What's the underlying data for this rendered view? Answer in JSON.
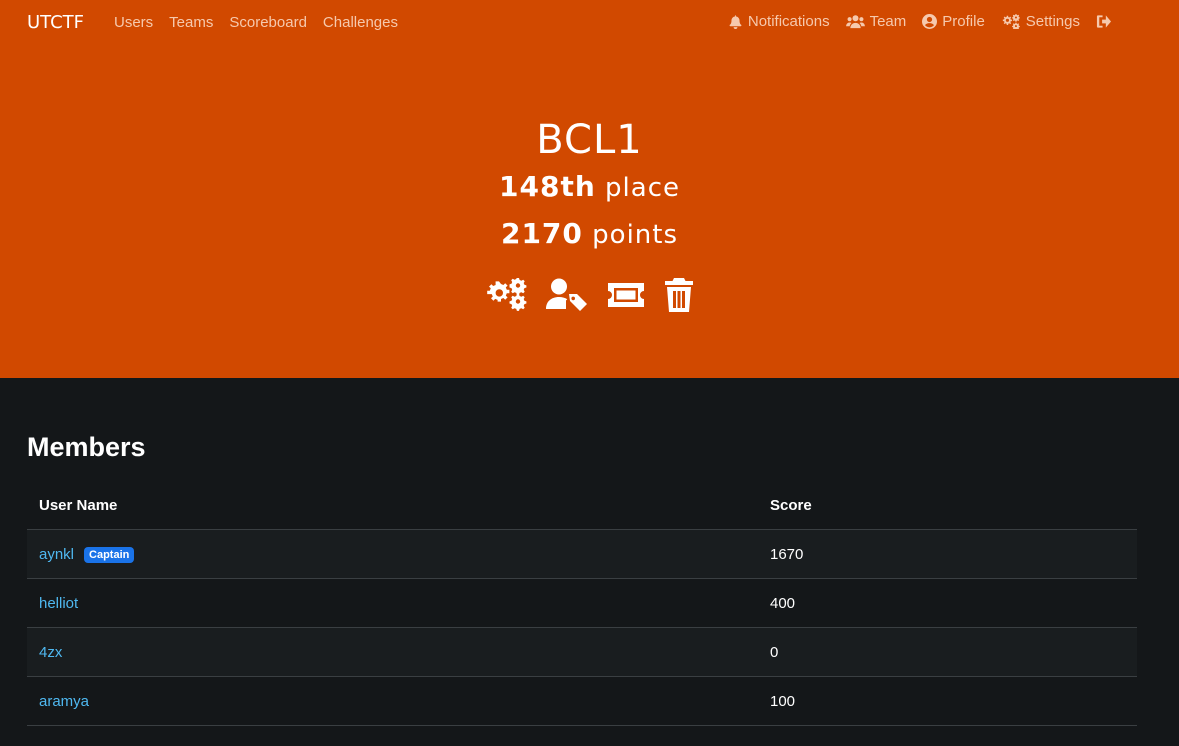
{
  "nav": {
    "brand": "UTCTF",
    "left_links": [
      "Users",
      "Teams",
      "Scoreboard",
      "Challenges"
    ],
    "right_links": [
      {
        "label": "Notifications",
        "icon": "bell-icon"
      },
      {
        "label": "Team",
        "icon": "users-icon"
      },
      {
        "label": "Profile",
        "icon": "user-circle-icon"
      },
      {
        "label": "Settings",
        "icon": "cogs-icon"
      }
    ],
    "logout_icon": "sign-out-icon"
  },
  "team": {
    "name": "BCL1",
    "place_value": "148th",
    "place_label": "place",
    "points_value": "2170",
    "points_label": "points",
    "admin_icons": [
      "cogs-icon",
      "user-tag-icon",
      "ticket-icon",
      "trash-icon"
    ]
  },
  "members": {
    "title": "Members",
    "headers": {
      "user": "User Name",
      "score": "Score"
    },
    "captain_badge": "Captain",
    "rows": [
      {
        "name": "aynkl",
        "score": "1670",
        "captain": true
      },
      {
        "name": "helliot",
        "score": "400",
        "captain": false
      },
      {
        "name": "4zx",
        "score": "0",
        "captain": false
      },
      {
        "name": "aramya",
        "score": "100",
        "captain": false
      }
    ]
  },
  "colors": {
    "hero_bg": "#d14900",
    "page_bg": "#141719",
    "link": "#4fb8f0",
    "badge": "#1a73e8"
  }
}
